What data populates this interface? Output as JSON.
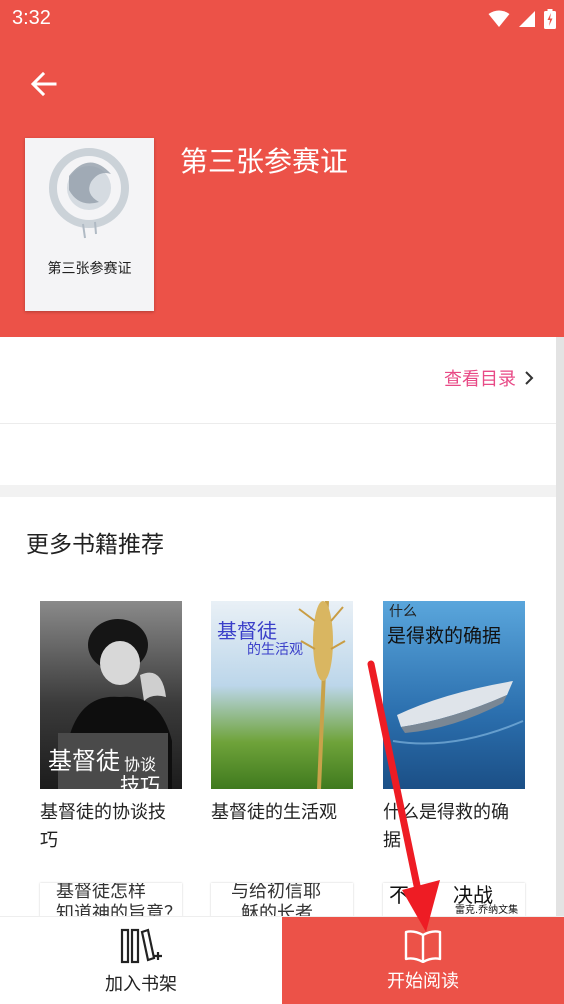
{
  "status_bar": {
    "time": "3:32"
  },
  "book": {
    "title": "第三张参赛证",
    "cover_title": "第三张参赛证"
  },
  "toc": {
    "label": "查看目录"
  },
  "recommendations": {
    "title": "更多书籍推荐",
    "items": [
      {
        "name": "基督徒的协谈技巧",
        "cover_text_1": "基督徒",
        "cover_text_2": "协谈",
        "cover_text_3": "技巧"
      },
      {
        "name": "基督徒的生活观",
        "cover_text_1": "基督徒",
        "cover_text_2": "的生活观"
      },
      {
        "name": "什么是得救的确据",
        "cover_text_1": "什么",
        "cover_text_2": "是得救的确据"
      }
    ],
    "partial_items": [
      {
        "cover_text_1": "基督徒怎样",
        "cover_text_2": "知道神的旨意？"
      },
      {
        "cover_text_1": "与给初信耶",
        "cover_text_2": "稣的长者"
      },
      {
        "cover_text_1": "不",
        "cover_text_2": "决战",
        "cover_text_3": "雷克.乔纳文集"
      }
    ]
  },
  "bottom_bar": {
    "add_shelf": "加入书架",
    "start_reading": "开始阅读"
  },
  "colors": {
    "primary": "#ec5248",
    "link": "#e84a86"
  }
}
